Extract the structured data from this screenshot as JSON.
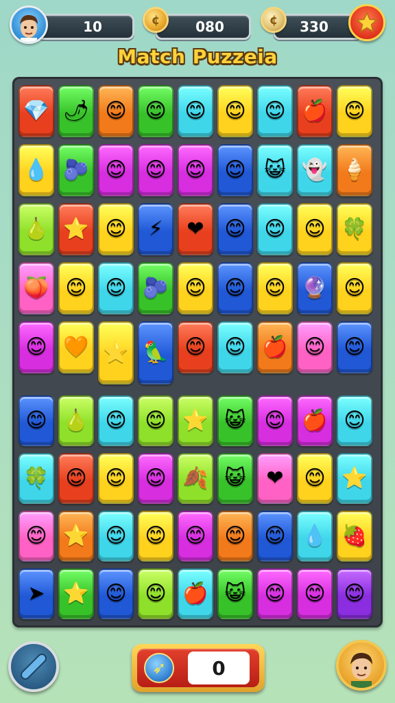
{
  "hud": {
    "lives_value": "10",
    "coins_value": "080",
    "score_value": "330",
    "player_avatar_icon": "player-portrait-icon",
    "coin_icon": "gold-coin-icon",
    "silver_coin_icon": "silver-coin-icon",
    "star_icon": "star-icon"
  },
  "title": "Match Puzzeia",
  "colors": {
    "red": "#e8401e",
    "green": "#38c22a",
    "orange": "#f27a1a",
    "yellow": "#ffd21e",
    "cyan": "#3fd6ea",
    "magenta": "#d72ee0",
    "blue": "#2058d6",
    "lime": "#8fe02a",
    "pink": "#ff62c4",
    "purple": "#8a2ee0"
  },
  "board": {
    "top_rows": [
      [
        [
          "red",
          "💎"
        ],
        [
          "green",
          "🌶"
        ],
        [
          "orange",
          "😊"
        ],
        [
          "green",
          "😊"
        ],
        [
          "cyan",
          "😊"
        ],
        [
          "yellow",
          "😊"
        ],
        [
          "cyan",
          "😊"
        ],
        [
          "red",
          "🍎"
        ],
        [
          "yellow",
          "😊"
        ]
      ],
      [
        [
          "yellow",
          "💧"
        ],
        [
          "green",
          "🫐"
        ],
        [
          "magenta",
          "😊"
        ],
        [
          "magenta",
          "😊"
        ],
        [
          "magenta",
          "😊"
        ],
        [
          "blue",
          "😊"
        ],
        [
          "cyan",
          "😺"
        ],
        [
          "cyan",
          "👻"
        ],
        [
          "orange",
          "🍦"
        ]
      ],
      [
        [
          "lime",
          "🍐"
        ],
        [
          "red",
          "⭐"
        ],
        [
          "yellow",
          "😊"
        ],
        [
          "blue",
          "⚡"
        ],
        [
          "red",
          "❤"
        ],
        [
          "blue",
          "😊"
        ],
        [
          "cyan",
          "😊"
        ],
        [
          "yellow",
          "😊"
        ],
        [
          "yellow",
          "🍀"
        ]
      ],
      [
        [
          "pink",
          "🍑"
        ],
        [
          "yellow",
          "😊"
        ],
        [
          "cyan",
          "😊"
        ],
        [
          "green",
          "🫐"
        ],
        [
          "yellow",
          "😊"
        ],
        [
          "blue",
          "😊"
        ],
        [
          "yellow",
          "😊"
        ],
        [
          "blue",
          "🔮"
        ],
        [
          "yellow",
          "😊"
        ]
      ],
      [
        [
          "magenta",
          "😊"
        ],
        [
          "yellow",
          "🧡"
        ],
        [
          "yellow",
          "⭐"
        ],
        [
          "blue",
          "🦜"
        ],
        [
          "red",
          "😊"
        ],
        [
          "cyan",
          "😊"
        ],
        [
          "orange",
          "🍎"
        ],
        [
          "pink",
          "😊"
        ],
        [
          "blue",
          "😊"
        ]
      ]
    ],
    "bottom_rows": [
      [
        [
          "blue",
          "😊"
        ],
        [
          "lime",
          "🍐"
        ],
        [
          "cyan",
          "😊"
        ],
        [
          "lime",
          "😊"
        ],
        [
          "lime",
          "⭐"
        ],
        [
          "green",
          "😺"
        ],
        [
          "magenta",
          "😊"
        ],
        [
          "magenta",
          "🍎"
        ],
        [
          "cyan",
          "😊"
        ]
      ],
      [
        [
          "cyan",
          "🍀"
        ],
        [
          "red",
          "😊"
        ],
        [
          "yellow",
          "😊"
        ],
        [
          "magenta",
          "😊"
        ],
        [
          "lime",
          "🍂"
        ],
        [
          "green",
          "😺"
        ],
        [
          "pink",
          "❤"
        ],
        [
          "yellow",
          "😊"
        ],
        [
          "cyan",
          "⭐"
        ]
      ],
      [
        [
          "pink",
          "😊"
        ],
        [
          "orange",
          "⭐"
        ],
        [
          "cyan",
          "😊"
        ],
        [
          "yellow",
          "😊"
        ],
        [
          "magenta",
          "😊"
        ],
        [
          "orange",
          "😊"
        ],
        [
          "blue",
          "😊"
        ],
        [
          "cyan",
          "💧"
        ],
        [
          "yellow",
          "🍓"
        ]
      ],
      [
        [
          "blue",
          "➤"
        ],
        [
          "green",
          "⭐"
        ],
        [
          "blue",
          "😊"
        ],
        [
          "lime",
          "😊"
        ],
        [
          "cyan",
          "🍎"
        ],
        [
          "green",
          "😺"
        ],
        [
          "magenta",
          "😊"
        ],
        [
          "magenta",
          "😊"
        ],
        [
          "purple",
          "😊"
        ]
      ]
    ]
  },
  "footer": {
    "score_value": "0",
    "left_button_icon": "slash-icon",
    "score_icon": "rocket-icon",
    "right_avatar_icon": "player-portrait-icon"
  }
}
